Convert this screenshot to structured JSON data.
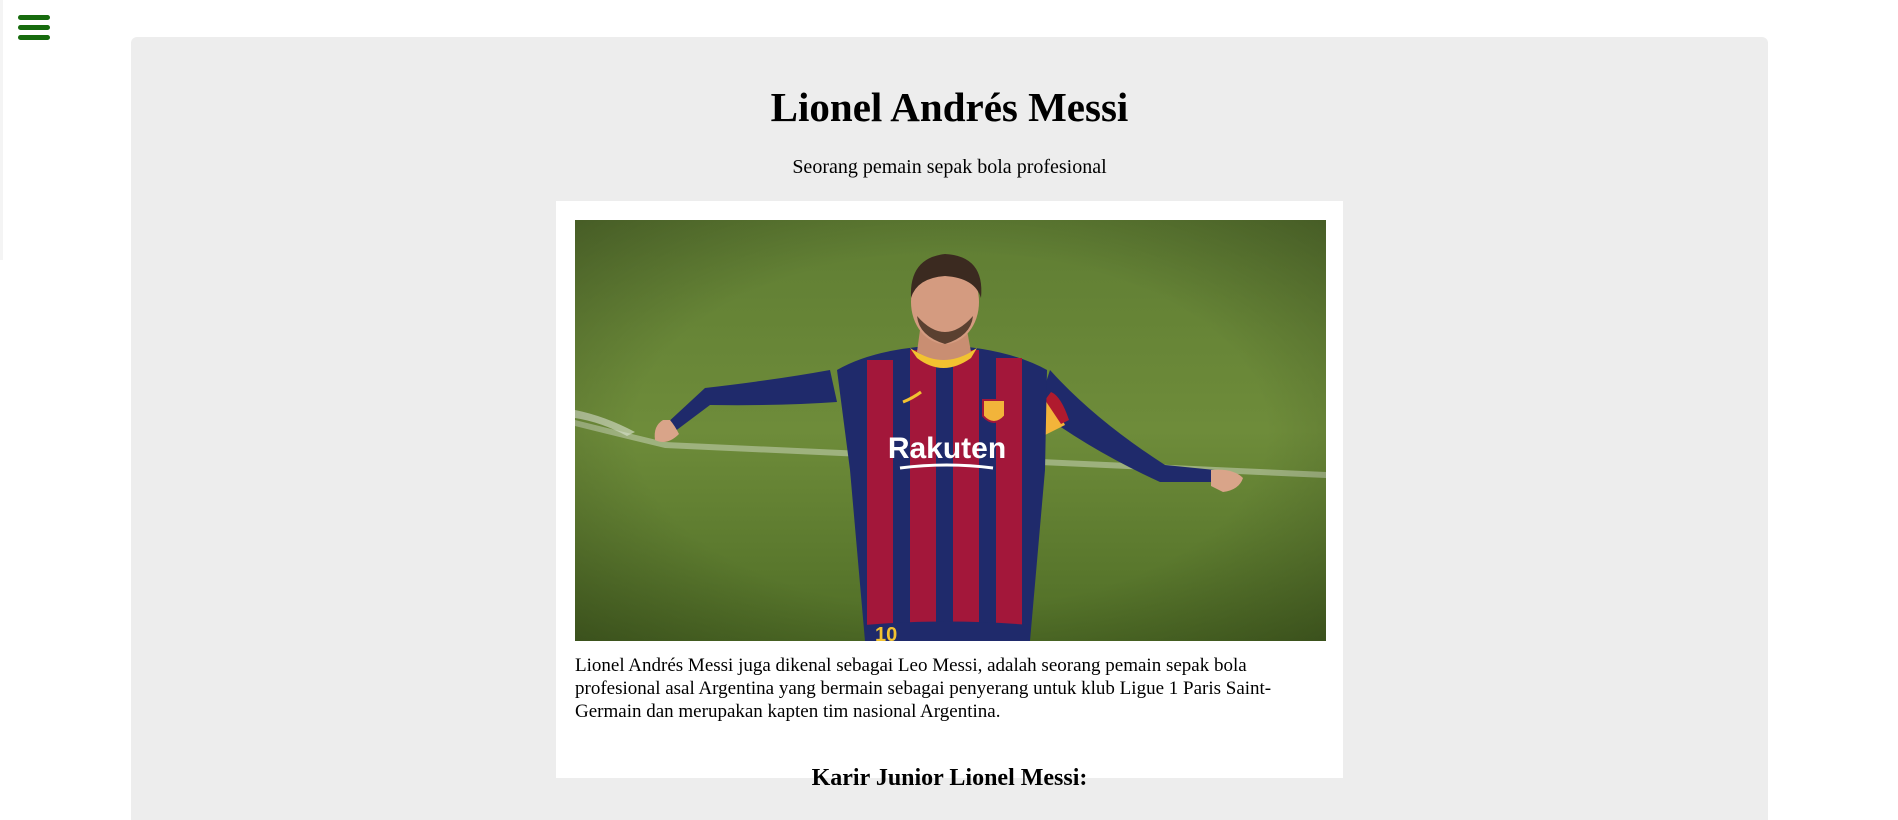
{
  "nav": {
    "menu_icon": "hamburger-menu-icon",
    "accent_color": "#176b0e"
  },
  "header": {
    "title": "Lionel Andrés Messi",
    "subtitle": "Seorang pemain sepak bola profesional"
  },
  "figure": {
    "photo_subject": "Lionel Messi in FC Barcelona kit celebrating on the pitch",
    "jersey_text": "Rakuten",
    "caption": "Lionel Andrés Messi juga dikenal sebagai Leo Messi, adalah seorang pemain sepak bola profesional asal Argentina yang bermain sebagai penyerang untuk klub Ligue 1 Paris Saint-Germain dan merupakan kapten tim nasional Argentina."
  },
  "sections": {
    "junior_career_heading": "Karir Junior Lionel Messi:"
  },
  "colors": {
    "card_background": "#ededed",
    "page_background": "#ffffff"
  }
}
